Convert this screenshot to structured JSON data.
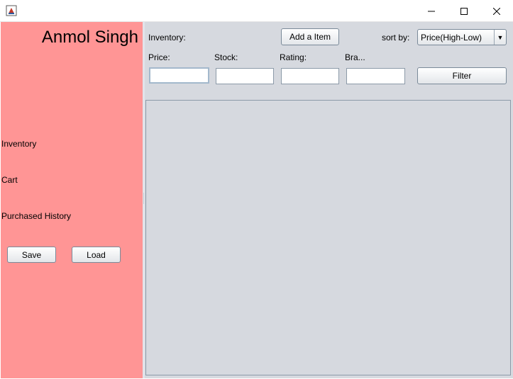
{
  "window": {
    "icons": {
      "app": "java-app-icon",
      "minimize": "minimize-icon",
      "maximize": "maximize-icon",
      "close": "close-icon"
    }
  },
  "sidebar": {
    "user_name": "Anmol Singh",
    "nav": [
      {
        "label": "Inventory"
      },
      {
        "label": "Cart"
      },
      {
        "label": "Purchased History"
      }
    ],
    "save_label": "Save",
    "load_label": "Load",
    "background": "#ff9595"
  },
  "header": {
    "section_label": "Inventory:",
    "add_item_label": "Add a Item",
    "sort_label": "sort by:",
    "sort_value": "Price(High-Low)",
    "filter_label": "Filter"
  },
  "filters": [
    {
      "label": "Price:",
      "value": ""
    },
    {
      "label": "Stock:",
      "value": ""
    },
    {
      "label": "Rating:",
      "value": ""
    },
    {
      "label": "Bra...",
      "value": ""
    }
  ],
  "colors": {
    "panel": "#d6d9df",
    "sidebar": "#ff9595",
    "focus": "#a3b8cc"
  }
}
